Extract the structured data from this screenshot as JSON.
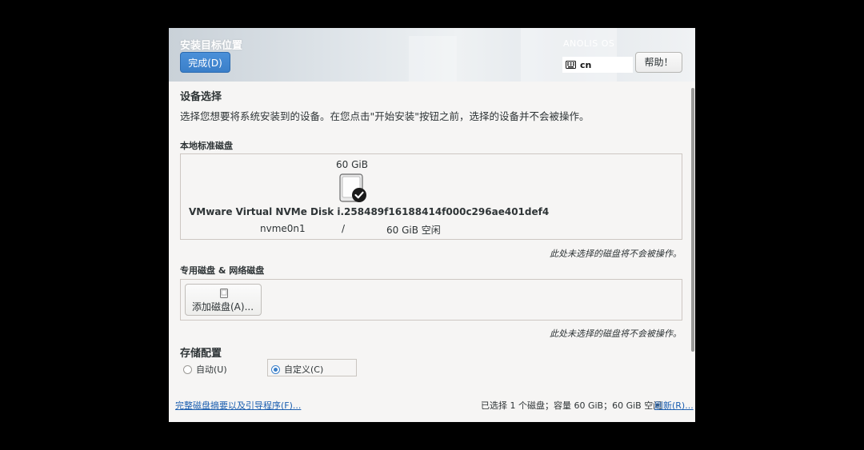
{
  "header": {
    "title": "安装目标位置",
    "done_label": "完成(D)",
    "brand": "ANOLIS OS",
    "keyboard_layout": "cn",
    "help_label": "帮助！"
  },
  "device_selection": {
    "heading": "设备选择",
    "description": "选择您想要将系统安装到的设备。在您点击\"开始安装\"按钮之前，选择的设备并不会被操作。"
  },
  "local_disks": {
    "heading": "本地标准磁盘",
    "disk": {
      "size": "60 GiB",
      "name": "VMware Virtual NVMe Disk i.258489f16188414f000c296ae401def4",
      "device": "nvme0n1",
      "mount": "/",
      "free": "60 GiB 空闲",
      "selected": true
    },
    "note": "此处未选择的磁盘将不会被操作。"
  },
  "special_disks": {
    "heading": "专用磁盘 & 网络磁盘",
    "add_label": "添加磁盘(A)...",
    "note": "此处未选择的磁盘将不会被操作。"
  },
  "storage_config": {
    "heading": "存储配置",
    "auto_label": "自动(U)",
    "custom_label": "自定义(C)",
    "selected": "custom"
  },
  "footer": {
    "summary_link": "完整磁盘摘要以及引导程序(F)...",
    "status": "已选择 1 个磁盘；容量 60 GiB；60 GiB 空闲",
    "refresh_link": "刷新(R)..."
  },
  "colors": {
    "accent": "#3b7fc9",
    "link": "#1c5fb0",
    "background": "#f6f5f4"
  }
}
